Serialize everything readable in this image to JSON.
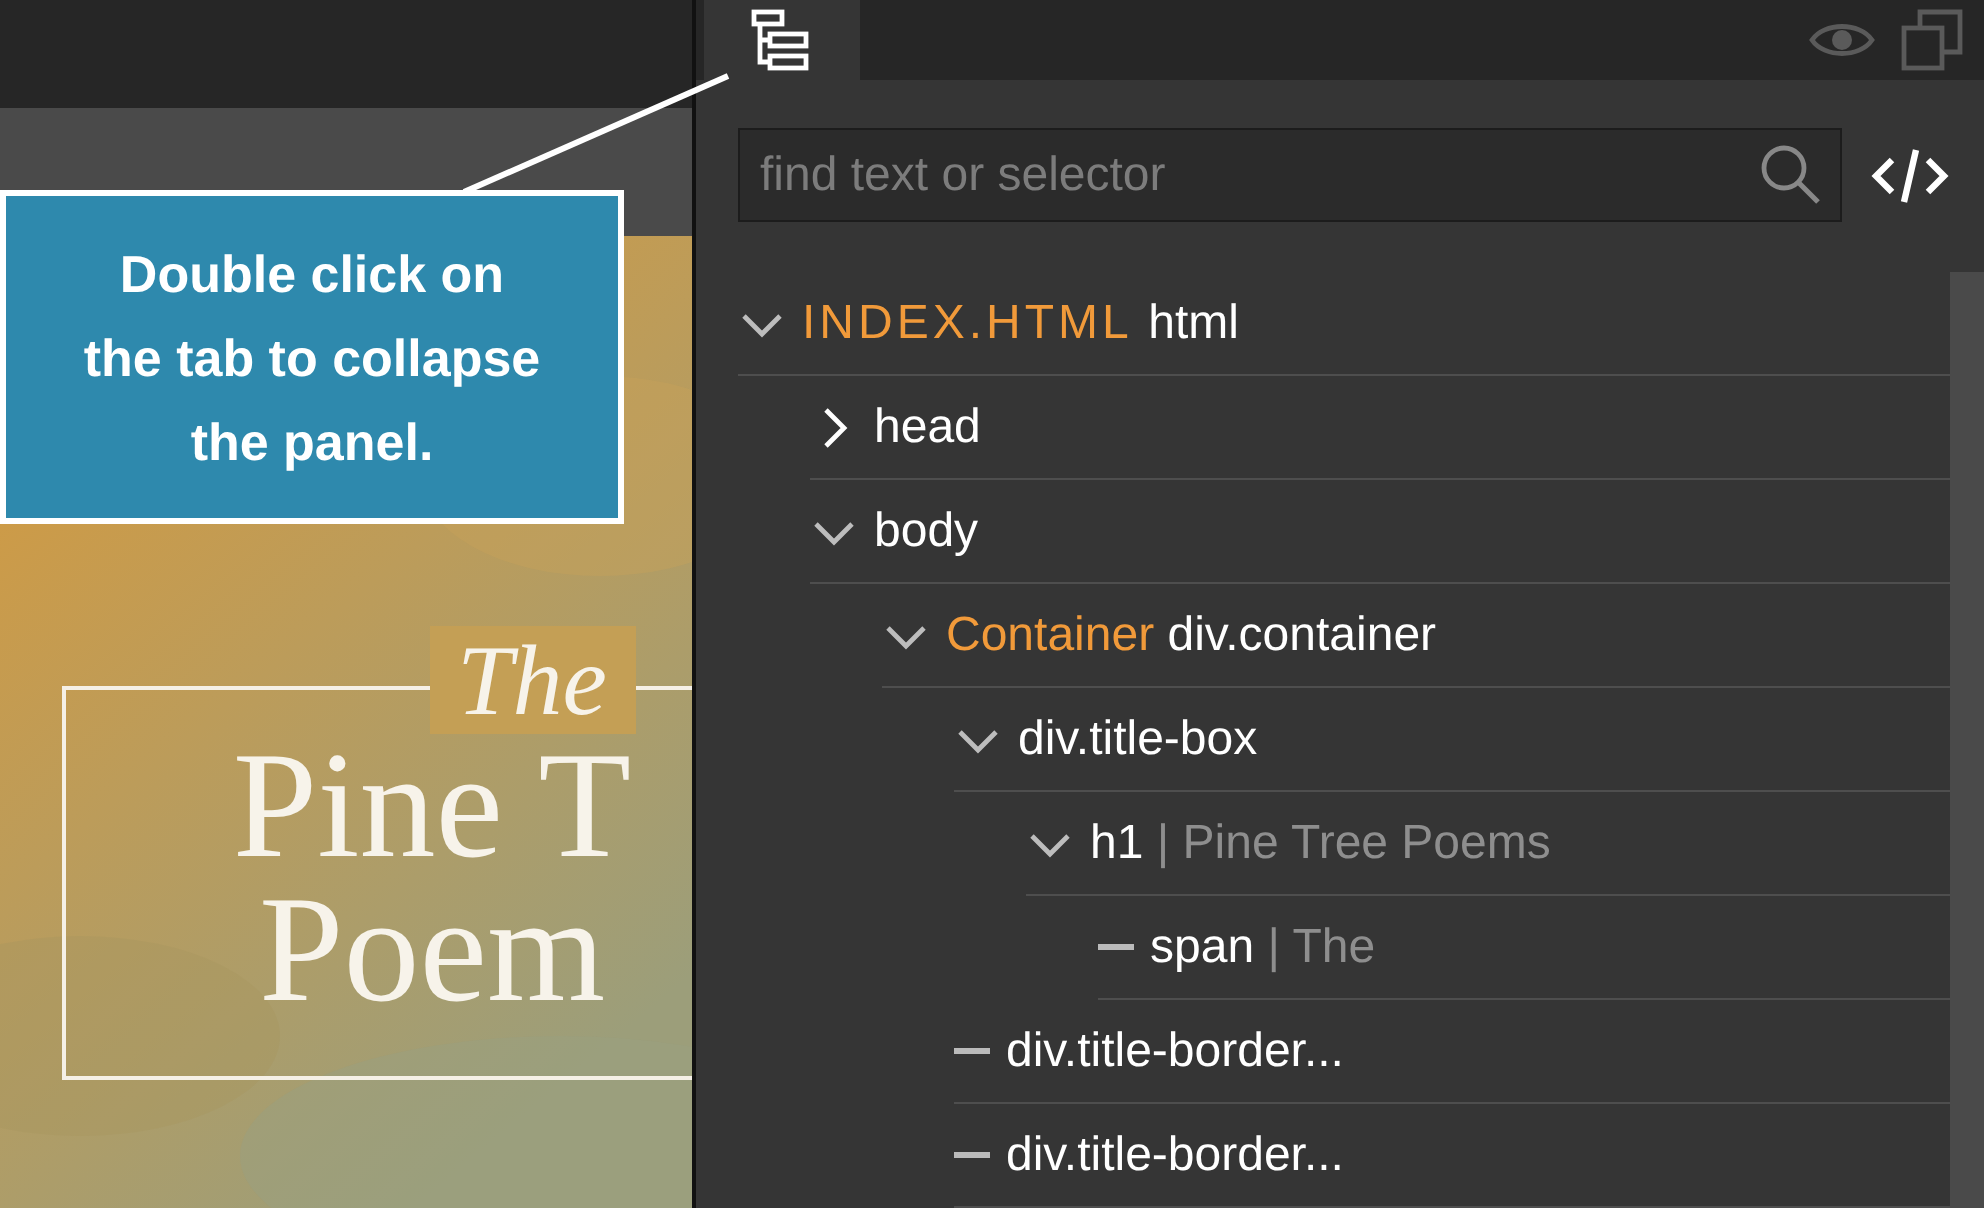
{
  "callout": {
    "text": "Double click on the tab to collapse the panel."
  },
  "preview": {
    "title_prefix": "The",
    "title_lines": [
      "Pine T",
      "Poem"
    ]
  },
  "panel": {
    "tabs": [
      {
        "kind": "tree",
        "selected": true
      }
    ],
    "search": {
      "placeholder": "find text or selector"
    },
    "tree": [
      {
        "kind": "branch",
        "expanded": true,
        "prefix": "INDEX.HTML",
        "name": "html",
        "children": [
          {
            "kind": "branch",
            "expanded": false,
            "name": "head"
          },
          {
            "kind": "branch",
            "expanded": true,
            "name": "body",
            "children": [
              {
                "kind": "branch",
                "expanded": true,
                "prefix": "Container",
                "name": "div.container",
                "children": [
                  {
                    "kind": "branch",
                    "expanded": true,
                    "name": "div.title-box",
                    "children": [
                      {
                        "kind": "branch",
                        "expanded": true,
                        "name": "h1",
                        "separator": "|",
                        "content": "Pine Tree Poems",
                        "children": [
                          {
                            "kind": "leaf",
                            "name": "span",
                            "separator": "|",
                            "content": "The"
                          }
                        ]
                      }
                    ]
                  },
                  {
                    "kind": "leaf",
                    "name": "div.title-border..."
                  },
                  {
                    "kind": "leaf",
                    "name": "div.title-border..."
                  }
                ]
              }
            ]
          }
        ]
      }
    ]
  }
}
